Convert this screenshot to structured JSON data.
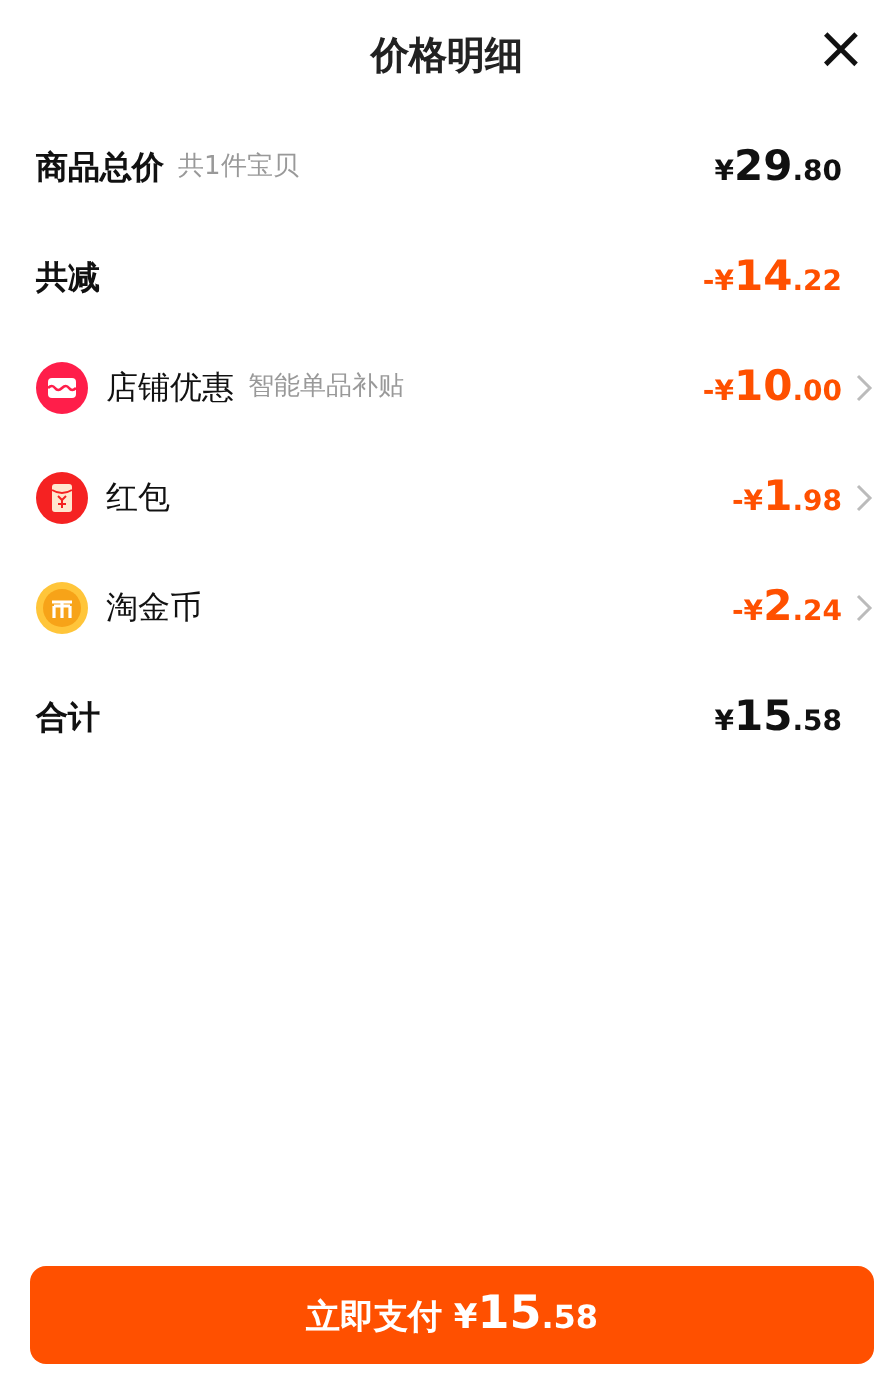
{
  "title": "价格明细",
  "close": "×",
  "rows": [
    {
      "kind": "plain",
      "label": "商品总价",
      "note": "共1件宝贝",
      "price": {
        "sign": "¥",
        "whole": "29",
        "cents": ".80"
      },
      "discount": false,
      "arrow": false
    },
    {
      "kind": "plain",
      "label": "共减",
      "price": {
        "sign": "-¥",
        "whole": "14",
        "cents": ".22"
      },
      "discount": true,
      "arrow": false
    },
    {
      "kind": "shop",
      "label": "店铺优惠",
      "note": "智能单品补贴",
      "price": {
        "sign": "-¥",
        "whole": "10",
        "cents": ".00"
      },
      "discount": true,
      "arrow": true
    },
    {
      "kind": "redpacket",
      "label": "红包",
      "price": {
        "sign": "-¥",
        "whole": "1",
        "cents": ".98"
      },
      "discount": true,
      "arrow": true
    },
    {
      "kind": "coin",
      "label": "淘金币",
      "price": {
        "sign": "-¥",
        "whole": "2",
        "cents": ".24"
      },
      "discount": true,
      "arrow": true
    },
    {
      "kind": "plain",
      "label": "合计",
      "price": {
        "sign": "¥",
        "whole": "15",
        "cents": ".58"
      },
      "discount": false,
      "arrow": false
    }
  ],
  "pay_button": {
    "label": "立即支付",
    "price": {
      "sign": "¥",
      "whole": "15",
      "cents": ".58"
    }
  }
}
